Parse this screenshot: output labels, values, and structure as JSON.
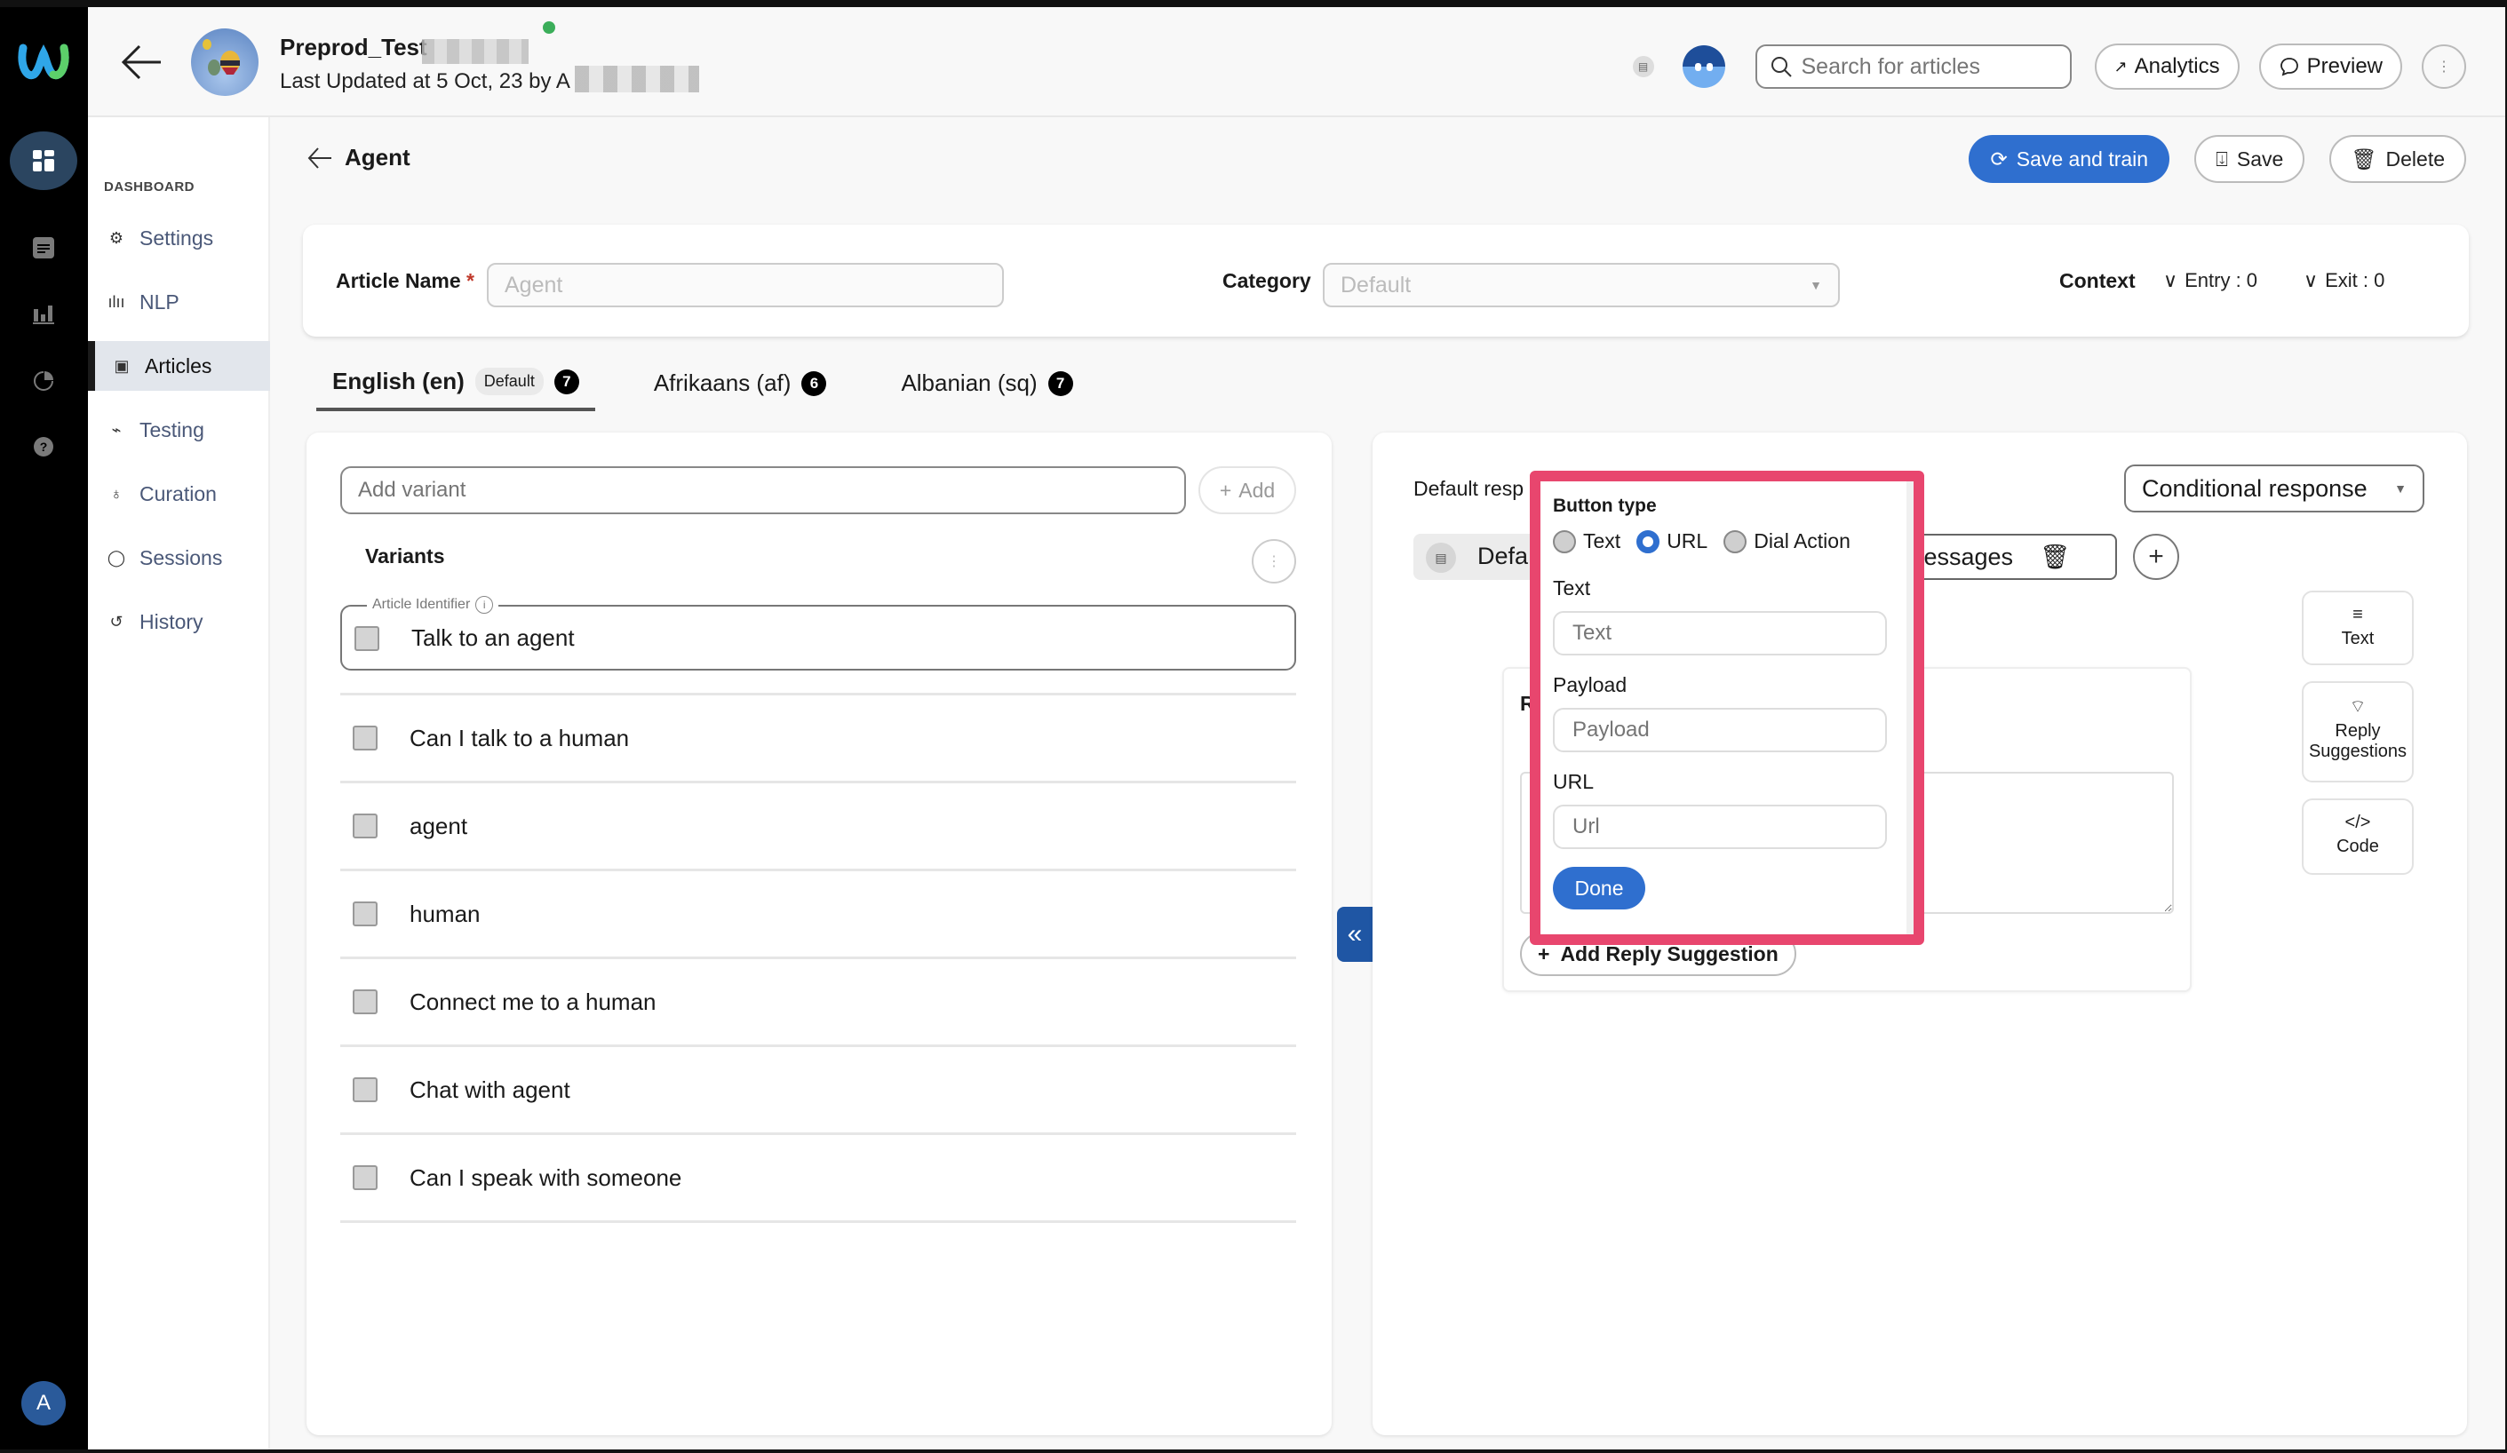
{
  "header": {
    "bot_name": "Preprod_Test",
    "last_updated": "Last Updated at 5 Oct, 23 by A",
    "search_placeholder": "Search for articles",
    "analytics_label": "Analytics",
    "preview_label": "Preview"
  },
  "nav": {
    "section_label": "DASHBOARD",
    "items": [
      {
        "label": "Settings",
        "icon": "gear-icon"
      },
      {
        "label": "NLP",
        "icon": "waveform-icon"
      },
      {
        "label": "Articles",
        "icon": "articles-icon",
        "active": true
      },
      {
        "label": "Testing",
        "icon": "testing-icon"
      },
      {
        "label": "Curation",
        "icon": "bulb-icon"
      },
      {
        "label": "Sessions",
        "icon": "chat-icon"
      },
      {
        "label": "History",
        "icon": "history-icon"
      }
    ]
  },
  "rail": {
    "avatar_initial": "A"
  },
  "page": {
    "title": "Agent",
    "save_train_label": "Save and train",
    "save_label": "Save",
    "delete_label": "Delete"
  },
  "meta": {
    "article_name_label": "Article Name",
    "required_mark": "*",
    "article_name_placeholder": "Agent",
    "category_label": "Category",
    "category_value": "Default",
    "context_label": "Context",
    "entry_label": "Entry : 0",
    "exit_label": "Exit : 0"
  },
  "tabs": [
    {
      "label": "English (en)",
      "tag": "Default",
      "count": "7",
      "active": true
    },
    {
      "label": "Afrikaans (af)",
      "count": "6"
    },
    {
      "label": "Albanian (sq)",
      "count": "7"
    }
  ],
  "variants": {
    "add_placeholder": "Add variant",
    "add_label": "Add",
    "title": "Variants",
    "identifier_label": "Article Identifier",
    "identifier_value": "Talk to an agent",
    "items": [
      "Can I talk to a human",
      "agent",
      "human",
      "Connect me to a human",
      "Chat with agent",
      "Can I speak with someone"
    ]
  },
  "response": {
    "default_label": "Default resp",
    "conditional_label": "Conditional response",
    "chip_label": "Defa",
    "messages_label": "Messages",
    "reply_card_letter": "R",
    "add_reply_suggestion": "Add Reply Suggestion",
    "tools": [
      {
        "label": "Text",
        "icon": "text-lines-icon"
      },
      {
        "label": "Reply Suggestions",
        "icon": "reply-suggestion-icon"
      },
      {
        "label": "Code",
        "icon": "code-icon"
      }
    ]
  },
  "popup": {
    "title": "Button type",
    "options": [
      "Text",
      "URL",
      "Dial Action"
    ],
    "selected": "URL",
    "text_label": "Text",
    "text_placeholder": "Text",
    "payload_label": "Payload",
    "payload_placeholder": "Payload",
    "url_label": "URL",
    "url_placeholder": "Url",
    "done_label": "Done",
    "highlight_color": "#e8466e"
  },
  "colors": {
    "accent": "#2f6fcf",
    "rail": "#000000"
  }
}
